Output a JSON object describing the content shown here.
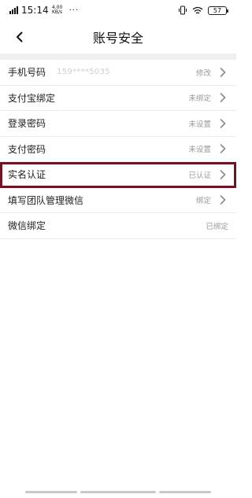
{
  "status_bar": {
    "time": "15:14",
    "speed": "4.00",
    "speed_unit": "KB/s",
    "dots": "···",
    "battery": "57"
  },
  "header": {
    "title": "账号安全"
  },
  "rows": [
    {
      "label": "手机号码",
      "sub": "159****5035",
      "status": "修改",
      "arrow": true
    },
    {
      "label": "支付宝绑定",
      "sub": "",
      "status": "未绑定",
      "arrow": true
    },
    {
      "label": "登录密码",
      "sub": "",
      "status": "未设置",
      "arrow": true
    },
    {
      "label": "支付密码",
      "sub": "",
      "status": "未设置",
      "arrow": true
    },
    {
      "label": "实名认证",
      "sub": "",
      "status": "已认证",
      "arrow": true
    },
    {
      "label": "填写团队管理微信",
      "sub": "",
      "status": "绑定",
      "arrow": true
    },
    {
      "label": "微信绑定",
      "sub": "",
      "status": "已绑定",
      "arrow": false
    }
  ]
}
